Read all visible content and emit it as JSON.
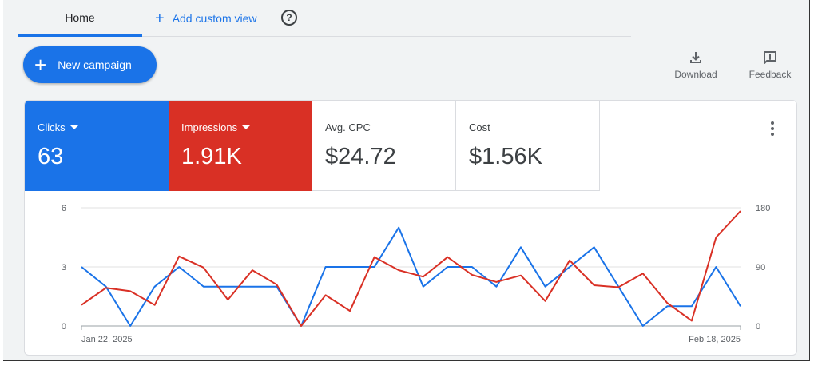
{
  "tabs": {
    "home_label": "Home",
    "add_view_label": "Add custom view"
  },
  "actions": {
    "new_campaign_label": "New campaign",
    "download_label": "Download",
    "feedback_label": "Feedback"
  },
  "metrics": [
    {
      "label": "Clicks",
      "value": "63",
      "color": "#1a73e8",
      "dropdown": true
    },
    {
      "label": "Impressions",
      "value": "1.91K",
      "color": "#d93025",
      "dropdown": true
    },
    {
      "label": "Avg. CPC",
      "value": "$24.72"
    },
    {
      "label": "Cost",
      "value": "$1.56K"
    }
  ],
  "chart_data": {
    "type": "line",
    "x": [
      "Jan 22, 2025",
      "Jan 23",
      "Jan 24",
      "Jan 25",
      "Jan 26",
      "Jan 27",
      "Jan 28",
      "Jan 29",
      "Jan 30",
      "Jan 31",
      "Feb 1",
      "Feb 2",
      "Feb 3",
      "Feb 4",
      "Feb 5",
      "Feb 6",
      "Feb 7",
      "Feb 8",
      "Feb 9",
      "Feb 10",
      "Feb 11",
      "Feb 12",
      "Feb 13",
      "Feb 14",
      "Feb 15",
      "Feb 16",
      "Feb 17",
      "Feb 18, 2025"
    ],
    "x_tick_labels": [
      "Jan 22, 2025",
      "Feb 18, 2025"
    ],
    "series": [
      {
        "axis": "left",
        "color": "#1a73e8",
        "values": [
          3,
          2,
          0,
          2,
          3,
          2,
          2,
          2,
          2,
          0,
          3,
          3,
          3,
          5,
          2,
          3,
          3,
          2,
          4,
          2,
          3,
          4,
          2,
          0,
          1,
          1,
          3,
          1
        ]
      },
      {
        "axis": "right",
        "color": "#d93025",
        "values": [
          32,
          58,
          53,
          32,
          106,
          89,
          40,
          85,
          63,
          0,
          47,
          23,
          105,
          85,
          75,
          105,
          78,
          67,
          77,
          38,
          100,
          62,
          59,
          80,
          35,
          8,
          135,
          175
        ]
      }
    ],
    "y_left": {
      "ticks": [
        0,
        3,
        6
      ],
      "ylim": [
        0,
        6
      ]
    },
    "y_right": {
      "ticks": [
        0,
        90,
        180
      ],
      "ylim": [
        0,
        180
      ]
    },
    "grid": true
  }
}
